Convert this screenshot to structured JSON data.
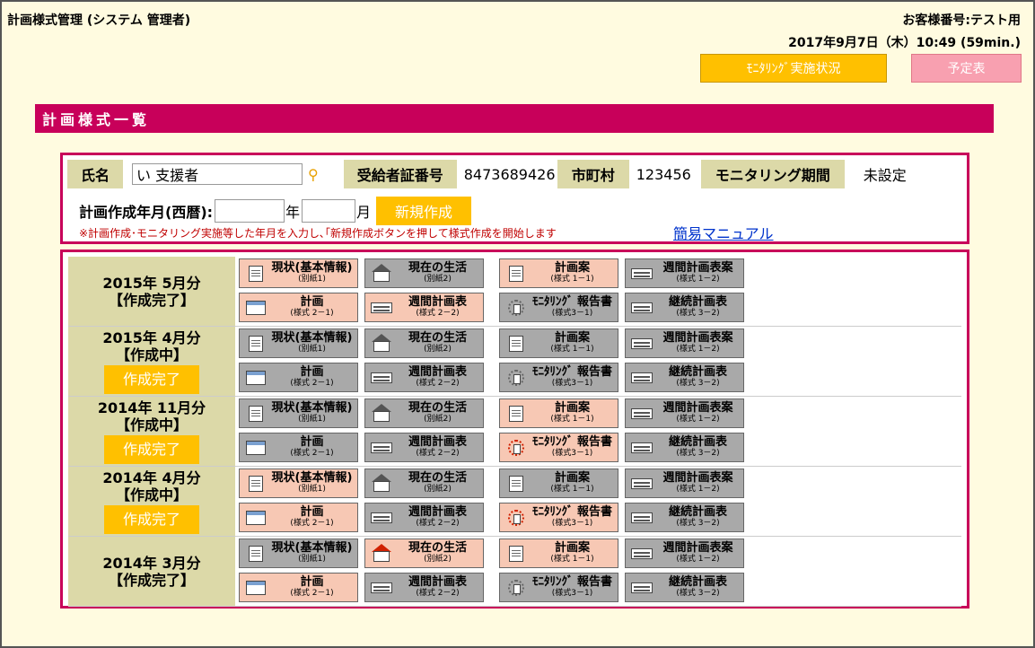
{
  "header": {
    "title": "計画様式管理 (システム 管理者)",
    "customer_no": "お客様番号:テスト用",
    "datetime": "2017年9月7日（木）10:49 (59min.)",
    "monitoring_button": "ﾓﾆﾀﾘﾝｸﾞ実施状況",
    "schedule_button": "予定表"
  },
  "section_title": "計画様式一覧",
  "info": {
    "name_label": "氏名",
    "name_value": "い 支援者",
    "cert_label": "受給者証番号",
    "cert_value": "8473689426",
    "city_label": "市町村",
    "city_value": "123456",
    "period_label": "モニタリング期間",
    "period_value": "未設定",
    "date_label": "計画作成年月(西暦):",
    "year_unit": "年",
    "month_unit": "月",
    "new_button": "新規作成",
    "note": "※計画作成･モニタリング実施等した年月を入力し､｢新規作成ボタンを押して様式作成を開始します",
    "manual_link": "簡易マニュアル"
  },
  "tile_defs": [
    {
      "title": "現状(基本情報)",
      "sub": "(別紙1)",
      "icon": "document-icon"
    },
    {
      "title": "現在の生活",
      "sub": "(別紙2)",
      "icon": "house-icon"
    },
    {
      "title": "計画案",
      "sub": "(様式 1－1)",
      "icon": "document-icon"
    },
    {
      "title": "週間計画表案",
      "sub": "(様式 1－2)",
      "icon": "schedule-bars-icon"
    },
    {
      "title": "計画",
      "sub": "(様式 2－1)",
      "icon": "calendar-icon"
    },
    {
      "title": "週間計画表",
      "sub": "(様式 2－2)",
      "icon": "schedule-bars-icon"
    },
    {
      "title": "ﾓﾆﾀﾘﾝｸﾞ 報告書",
      "sub": "(様式3－1)",
      "icon": "gear-icon"
    },
    {
      "title": "継続計画表",
      "sub": "(様式 3－2)",
      "icon": "schedule-bars-icon"
    }
  ],
  "done_button": "作成完了",
  "rows": [
    {
      "period": "2015年 5月分",
      "status": "【作成完了】",
      "show_done": false,
      "active": [
        true,
        false,
        true,
        false,
        true,
        true,
        false,
        false
      ],
      "red_icons": []
    },
    {
      "period": "2015年 4月分",
      "status": "【作成中】",
      "show_done": true,
      "active": [
        false,
        false,
        false,
        false,
        false,
        false,
        false,
        false
      ],
      "red_icons": []
    },
    {
      "period": "2014年 11月分",
      "status": "【作成中】",
      "show_done": true,
      "active": [
        false,
        false,
        true,
        false,
        false,
        false,
        true,
        false
      ],
      "red_icons": [
        6
      ]
    },
    {
      "period": "2014年 4月分",
      "status": "【作成中】",
      "show_done": true,
      "active": [
        true,
        false,
        false,
        false,
        true,
        false,
        true,
        false
      ],
      "red_icons": [
        6
      ]
    },
    {
      "period": "2014年 3月分",
      "status": "【作成完了】",
      "show_done": false,
      "active": [
        false,
        true,
        true,
        false,
        true,
        false,
        false,
        false
      ],
      "red_icons": [
        1
      ]
    }
  ]
}
